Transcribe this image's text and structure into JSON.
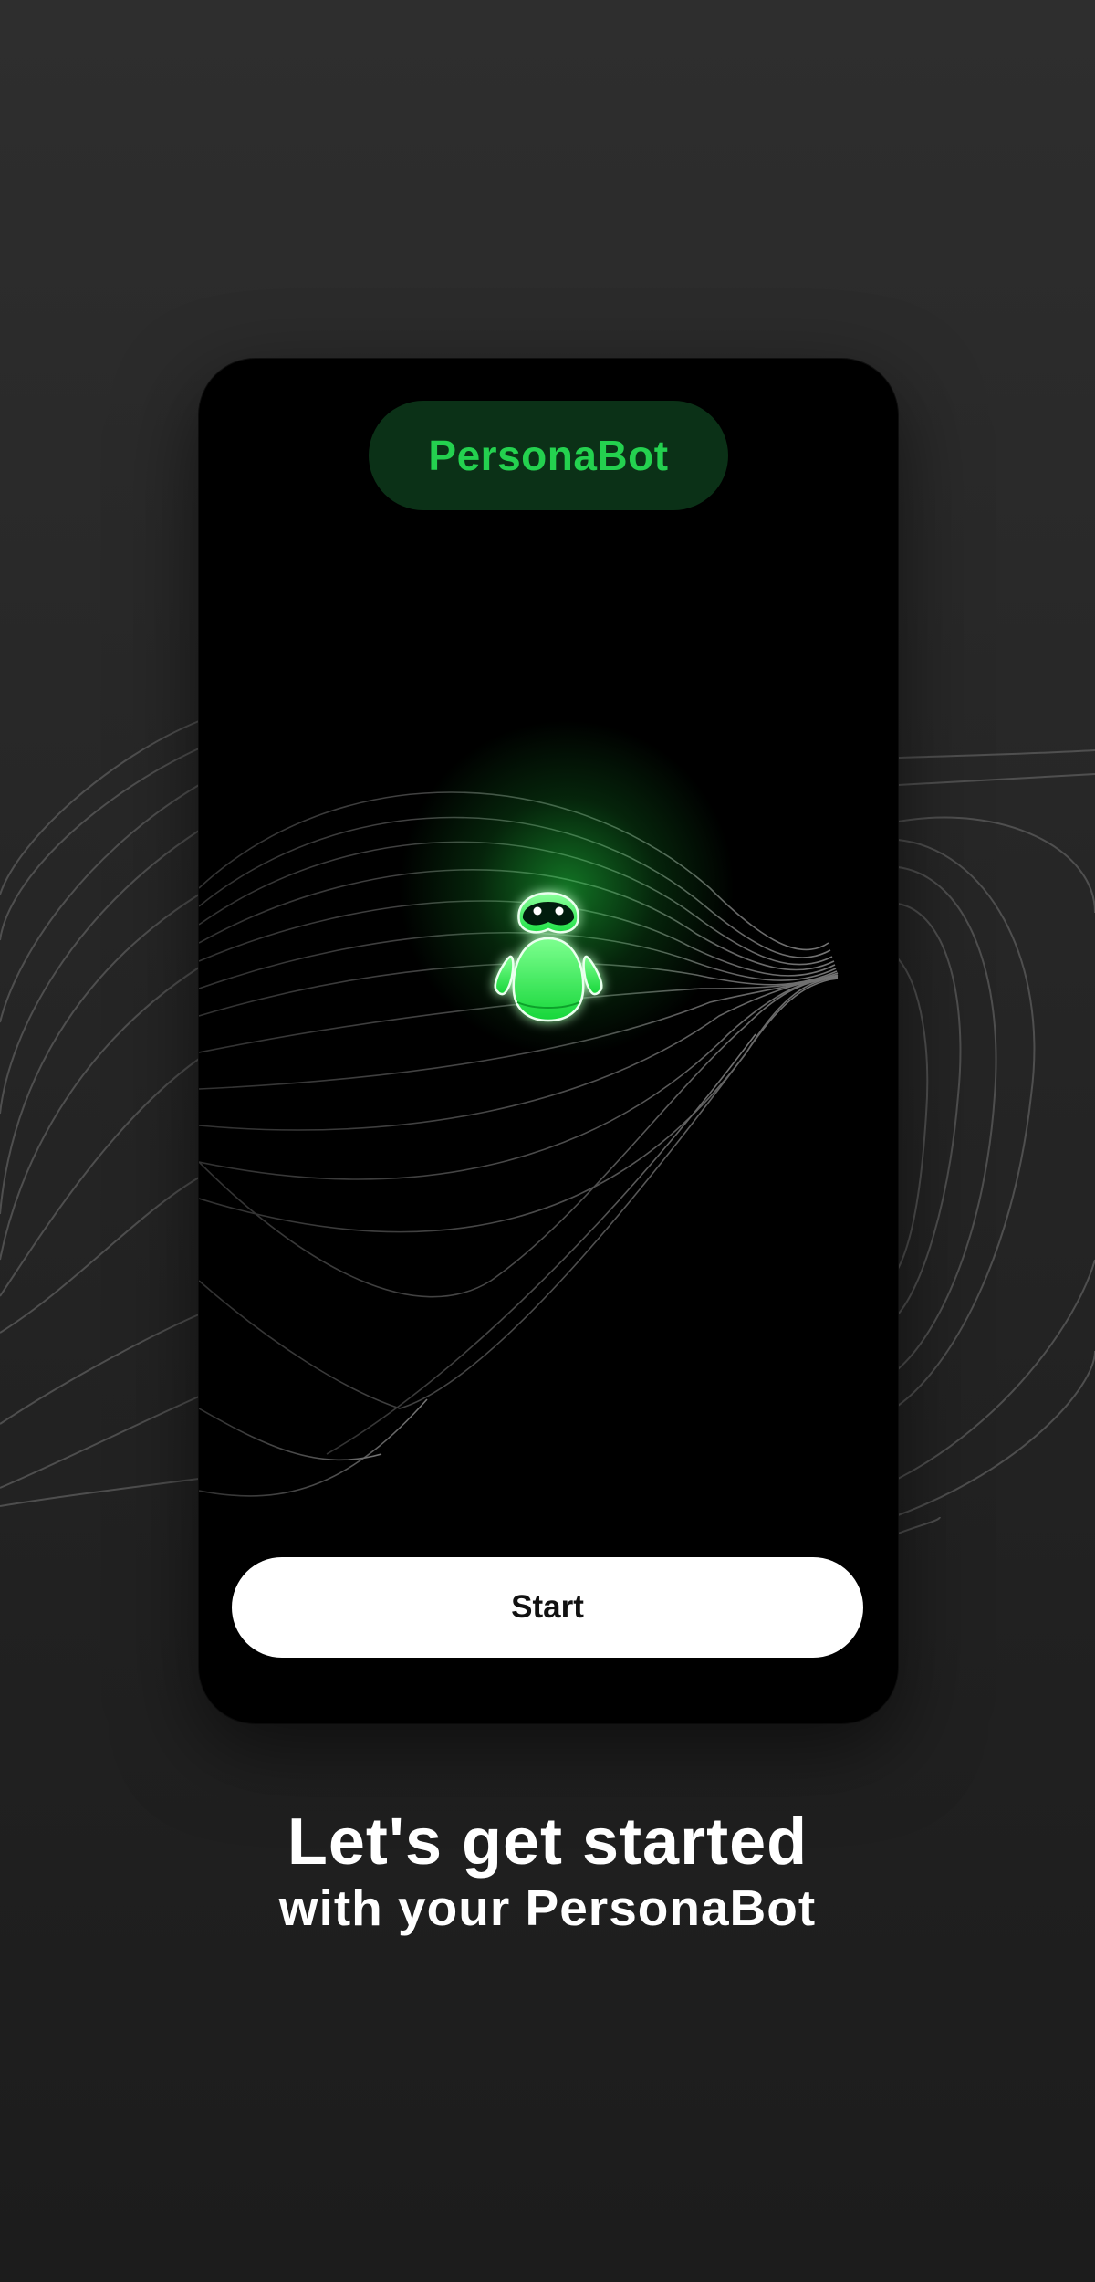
{
  "app": {
    "brand_name": "PersonaBot"
  },
  "hero": {
    "illustration": "robot-mascot-icon"
  },
  "actions": {
    "start_label": "Start"
  },
  "caption": {
    "headline": "Let's get started",
    "subline": "with your PersonaBot"
  },
  "colors": {
    "accent": "#24d14f",
    "pill_background": "#0b3117",
    "button_background": "#ffffff",
    "screen_background": "#000000",
    "page_background": "#262626"
  }
}
